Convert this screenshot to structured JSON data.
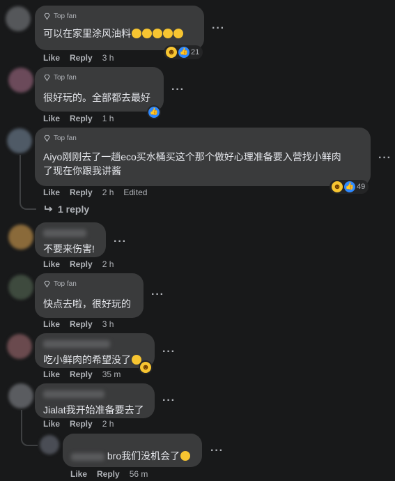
{
  "badge": {
    "top_fan": "Top fan"
  },
  "actions": {
    "like": "Like",
    "reply": "Reply"
  },
  "comments": [
    {
      "text": "可以在家里涂风油料",
      "time": "3 h",
      "reaction_count": "21"
    },
    {
      "text": "很好玩的。全部都去最好",
      "time": "1 h"
    },
    {
      "text_line1": "Aiyo刚刚去了一趟eco买水桶买这个那个做好心理准备要入营找小鲜肉",
      "text_line2": "了现在你跟我讲酱",
      "time": "2 h",
      "edited": "Edited",
      "reaction_count": "49",
      "replies_link": "1 reply"
    },
    {
      "text": "不要来伤害!",
      "time": "2 h"
    },
    {
      "text": "快点去啦，很好玩的",
      "time": "3 h"
    },
    {
      "text": "吃小鲜肉的希望没了",
      "time": "35 m"
    },
    {
      "text": "Jialat我开始准备要去了",
      "time": "2 h"
    },
    {
      "text": "bro我们没机会了",
      "time": "56 m"
    }
  ],
  "colors": {
    "background": "#18191a",
    "bubble": "#3a3b3c",
    "muted_text": "#b0b3b8",
    "like_blue": "#2e89ff",
    "emoji_yellow": "#f7c531"
  },
  "icons": [
    "diamond-icon",
    "more-dots-icon",
    "like-reaction-icon",
    "haha-reaction-icon",
    "reply-arrow-icon"
  ]
}
